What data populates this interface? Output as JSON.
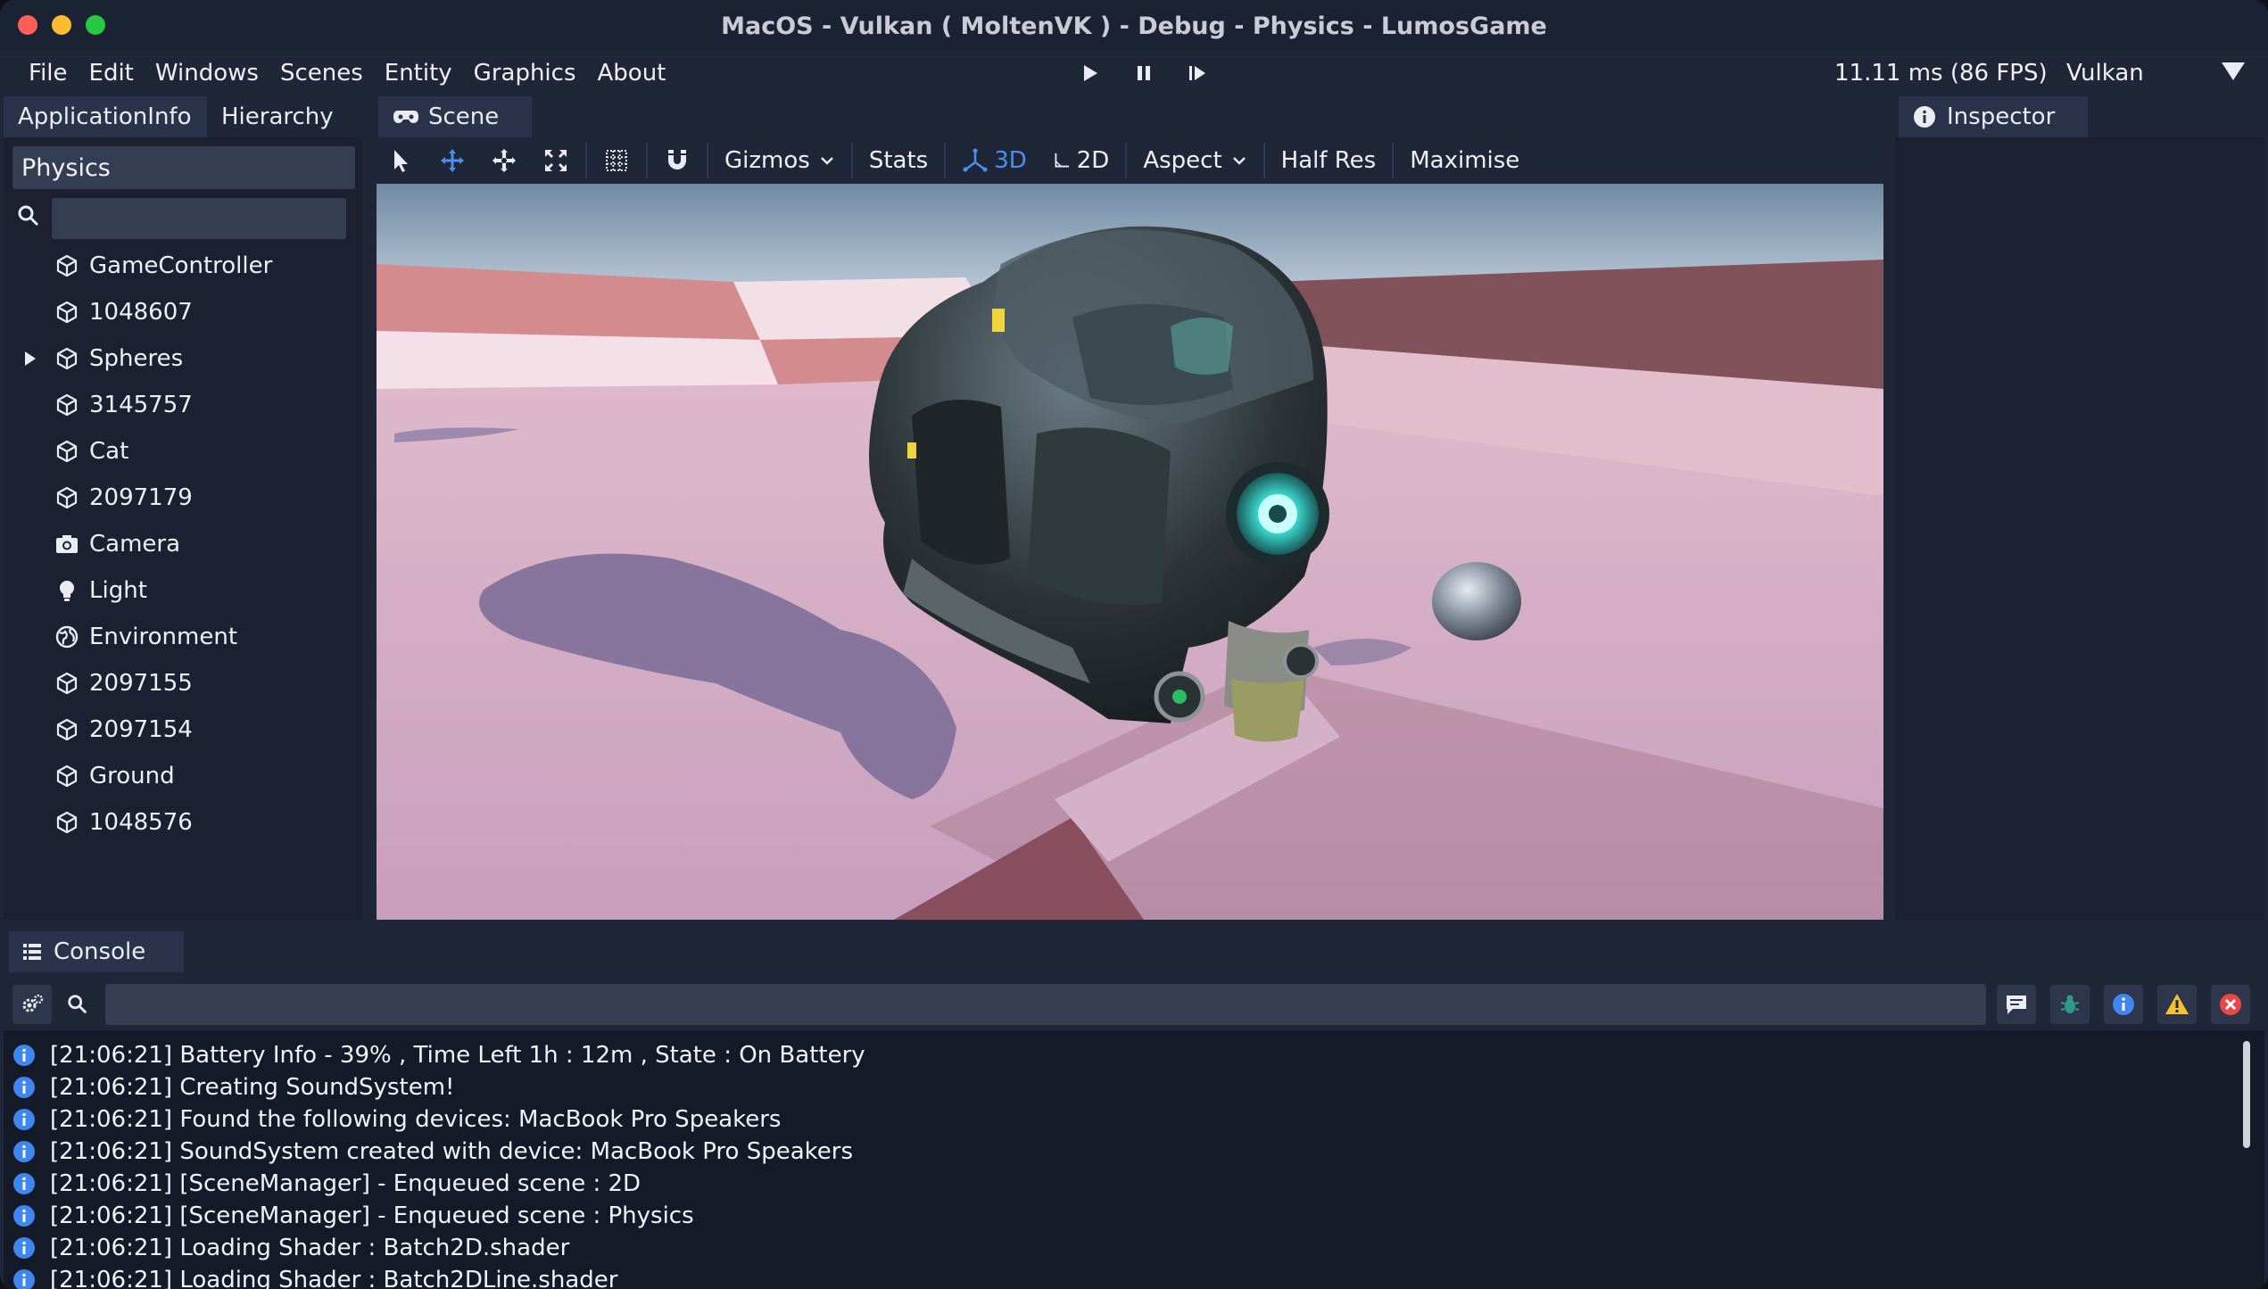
{
  "window": {
    "title": "MacOS - Vulkan ( MoltenVK ) - Debug - Physics - LumosGame"
  },
  "menu": {
    "items": [
      "File",
      "Edit",
      "Windows",
      "Scenes",
      "Entity",
      "Graphics",
      "About"
    ],
    "frame_time": "11.11 ms (86 FPS)",
    "render_api": "Vulkan"
  },
  "tabs": {
    "application_info": "ApplicationInfo",
    "hierarchy": "Hierarchy",
    "scene": "Scene",
    "inspector": "Inspector",
    "console": "Console"
  },
  "hierarchy": {
    "scene_name": "Physics",
    "search_value": "",
    "items": [
      {
        "label": "GameController",
        "icon": "cube-icon"
      },
      {
        "label": "1048607",
        "icon": "cube-icon"
      },
      {
        "label": "Spheres",
        "icon": "cube-icon",
        "expandable": true
      },
      {
        "label": "3145757",
        "icon": "cube-icon"
      },
      {
        "label": "Cat",
        "icon": "cube-icon"
      },
      {
        "label": "2097179",
        "icon": "cube-icon"
      },
      {
        "label": "Camera",
        "icon": "camera-icon"
      },
      {
        "label": "Light",
        "icon": "lightbulb-icon"
      },
      {
        "label": "Environment",
        "icon": "globe-icon"
      },
      {
        "label": "2097155",
        "icon": "cube-icon"
      },
      {
        "label": "2097154",
        "icon": "cube-icon"
      },
      {
        "label": "Ground",
        "icon": "cube-icon"
      },
      {
        "label": "1048576",
        "icon": "cube-icon"
      }
    ]
  },
  "scene_toolbar": {
    "gizmos": "Gizmos",
    "stats": "Stats",
    "mode_3d": "3D",
    "mode_2d": "2D",
    "aspect": "Aspect",
    "half_res": "Half Res",
    "maximise": "Maximise"
  },
  "console": {
    "filter_value": "",
    "lines": [
      "[21:06:21] Battery Info - 39% , Time Left 1h : 12m , State : On Battery",
      "[21:06:21] Creating SoundSystem!",
      "[21:06:21] Found the following devices: MacBook Pro Speakers",
      "[21:06:21] SoundSystem created with device: MacBook Pro Speakers",
      "[21:06:21] [SceneManager] - Enqueued scene : 2D",
      "[21:06:21] [SceneManager] - Enqueued scene : Physics",
      "[21:06:21] Loading Shader : Batch2D.shader",
      "[21:06:21] Loading Shader : Batch2DLine.shader"
    ]
  },
  "colors": {
    "window_bg": "#1f2637",
    "panel_bg": "#1b2130",
    "accent": "#4d8ef0",
    "info": "#3f86f0",
    "warning": "#f6c12d",
    "error": "#e9484b"
  }
}
